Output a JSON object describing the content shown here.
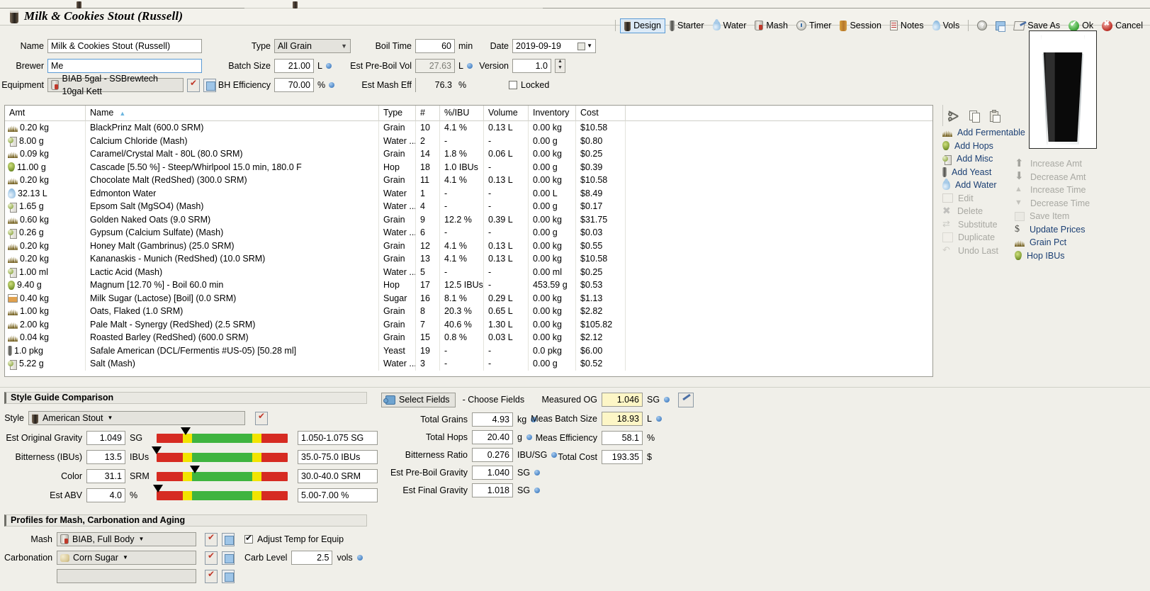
{
  "window": {
    "title": "Milk & Cookies Stout (Russell)",
    "title_icon": "beer-glass-icon"
  },
  "toolbar": {
    "items": [
      {
        "label": "Design",
        "icon": "beer-glass-icon",
        "active": true
      },
      {
        "label": "Starter",
        "icon": "test-tube-icon",
        "active": false
      },
      {
        "label": "Water",
        "icon": "water-drop-icon",
        "active": false
      },
      {
        "label": "Mash",
        "icon": "mash-tun-icon",
        "active": false
      },
      {
        "label": "Timer",
        "icon": "timer-icon",
        "active": false
      },
      {
        "label": "Session",
        "icon": "fermenter-icon",
        "active": false
      },
      {
        "label": "Notes",
        "icon": "notes-icon",
        "active": false
      },
      {
        "label": "Vols",
        "icon": "water-drop-icon",
        "active": false
      }
    ],
    "help_label": "?",
    "save_icon_label": "",
    "save_as_label": "Save As",
    "ok_label": "Ok",
    "cancel_label": "Cancel"
  },
  "form": {
    "name_label": "Name",
    "name_value": "Milk & Cookies Stout (Russell)",
    "brewer_label": "Brewer",
    "brewer_value": "Me",
    "equipment_label": "Equipment",
    "equipment_value": "BIAB 5gal - SSBrewtech 10gal Kett",
    "type_label": "Type",
    "type_value": "All Grain",
    "batch_size_label": "Batch Size",
    "batch_size_value": "21.00",
    "batch_size_unit": "L",
    "bh_efficiency_label": "BH Efficiency",
    "bh_efficiency_value": "70.00",
    "bh_efficiency_unit": "%",
    "boil_time_label": "Boil Time",
    "boil_time_value": "60",
    "boil_time_unit": "min",
    "est_pre_boil_vol_label": "Est Pre-Boil Vol",
    "est_pre_boil_vol_value": "27.63",
    "est_pre_boil_vol_unit": "L",
    "est_mash_eff_label": "Est Mash Eff",
    "est_mash_eff_value": "76.3",
    "est_mash_eff_unit": "%",
    "date_label": "Date",
    "date_value": "2019-09-19",
    "version_label": "Version",
    "version_value": "1.0",
    "locked_label": "Locked",
    "locked_checked": false
  },
  "ingredients": {
    "columns": [
      "Amt",
      "Name",
      "Type",
      "#",
      "%/IBU",
      "Volume",
      "Inventory",
      "Cost"
    ],
    "sorted_column": "Name",
    "rows": [
      {
        "icon": "grain-icon",
        "amt": "0.20 kg",
        "name": "BlackPrinz Malt (600.0 SRM)",
        "type": "Grain",
        "num": "10",
        "pct": "4.1 %",
        "volume": "0.13 L",
        "inventory": "0.00 kg",
        "cost": "$10.58"
      },
      {
        "icon": "misc-icon",
        "amt": "8.00 g",
        "name": "Calcium Chloride (Mash)",
        "type": "Water ...",
        "num": "2",
        "pct": "-",
        "volume": "-",
        "inventory": "0.00 g",
        "cost": "$0.80"
      },
      {
        "icon": "grain-icon",
        "amt": "0.09 kg",
        "name": "Caramel/Crystal Malt - 80L (80.0 SRM)",
        "type": "Grain",
        "num": "14",
        "pct": "1.8 %",
        "volume": "0.06 L",
        "inventory": "0.00 kg",
        "cost": "$0.25"
      },
      {
        "icon": "hop-icon",
        "amt": "11.00 g",
        "name": "Cascade [5.50 %] - Steep/Whirlpool  15.0 min, 180.0 F",
        "type": "Hop",
        "num": "18",
        "pct": "1.0 IBUs",
        "volume": "-",
        "inventory": "0.00 g",
        "cost": "$0.39"
      },
      {
        "icon": "grain-icon",
        "amt": "0.20 kg",
        "name": "Chocolate Malt (RedShed) (300.0 SRM)",
        "type": "Grain",
        "num": "11",
        "pct": "4.1 %",
        "volume": "0.13 L",
        "inventory": "0.00 kg",
        "cost": "$10.58"
      },
      {
        "icon": "water-icon",
        "amt": "32.13 L",
        "name": "Edmonton Water",
        "type": "Water",
        "num": "1",
        "pct": "-",
        "volume": "-",
        "inventory": "0.00 L",
        "cost": "$8.49"
      },
      {
        "icon": "misc-icon",
        "amt": "1.65 g",
        "name": "Epsom Salt (MgSO4) (Mash)",
        "type": "Water ...",
        "num": "4",
        "pct": "-",
        "volume": "-",
        "inventory": "0.00 g",
        "cost": "$0.17"
      },
      {
        "icon": "grain-icon",
        "amt": "0.60 kg",
        "name": "Golden Naked Oats (9.0 SRM)",
        "type": "Grain",
        "num": "9",
        "pct": "12.2 %",
        "volume": "0.39 L",
        "inventory": "0.00 kg",
        "cost": "$31.75"
      },
      {
        "icon": "misc-icon",
        "amt": "0.26 g",
        "name": "Gypsum (Calcium Sulfate) (Mash)",
        "type": "Water ...",
        "num": "6",
        "pct": "-",
        "volume": "-",
        "inventory": "0.00 g",
        "cost": "$0.03"
      },
      {
        "icon": "grain-icon",
        "amt": "0.20 kg",
        "name": "Honey Malt (Gambrinus) (25.0 SRM)",
        "type": "Grain",
        "num": "12",
        "pct": "4.1 %",
        "volume": "0.13 L",
        "inventory": "0.00 kg",
        "cost": "$0.55"
      },
      {
        "icon": "grain-icon",
        "amt": "0.20 kg",
        "name": "Kananaskis - Munich (RedShed) (10.0 SRM)",
        "type": "Grain",
        "num": "13",
        "pct": "4.1 %",
        "volume": "0.13 L",
        "inventory": "0.00 kg",
        "cost": "$10.58"
      },
      {
        "icon": "misc-icon",
        "amt": "1.00 ml",
        "name": "Lactic Acid (Mash)",
        "type": "Water ...",
        "num": "5",
        "pct": "-",
        "volume": "-",
        "inventory": "0.00 ml",
        "cost": "$0.25"
      },
      {
        "icon": "hop-icon",
        "amt": "9.40 g",
        "name": "Magnum [12.70 %] - Boil 60.0 min",
        "type": "Hop",
        "num": "17",
        "pct": "12.5 IBUs",
        "volume": "-",
        "inventory": "453.59 g",
        "cost": "$0.53"
      },
      {
        "icon": "sugar-icon",
        "amt": "0.40 kg",
        "name": "Milk Sugar (Lactose) [Boil] (0.0 SRM)",
        "type": "Sugar",
        "num": "16",
        "pct": "8.1 %",
        "volume": "0.29 L",
        "inventory": "0.00 kg",
        "cost": "$1.13"
      },
      {
        "icon": "grain-icon",
        "amt": "1.00 kg",
        "name": "Oats, Flaked (1.0 SRM)",
        "type": "Grain",
        "num": "8",
        "pct": "20.3 %",
        "volume": "0.65 L",
        "inventory": "0.00 kg",
        "cost": "$2.82"
      },
      {
        "icon": "grain-icon",
        "amt": "2.00 kg",
        "name": "Pale Malt - Synergy (RedShed) (2.5 SRM)",
        "type": "Grain",
        "num": "7",
        "pct": "40.6 %",
        "volume": "1.30 L",
        "inventory": "0.00 kg",
        "cost": "$105.82"
      },
      {
        "icon": "grain-icon",
        "amt": "0.04 kg",
        "name": "Roasted Barley (RedShed) (600.0 SRM)",
        "type": "Grain",
        "num": "15",
        "pct": "0.8 %",
        "volume": "0.03 L",
        "inventory": "0.00 kg",
        "cost": "$2.12"
      },
      {
        "icon": "yeast-icon",
        "amt": "1.0 pkg",
        "name": "Safale American  (DCL/Fermentis #US-05) [50.28 ml]",
        "type": "Yeast",
        "num": "19",
        "pct": "-",
        "volume": "-",
        "inventory": "0.0 pkg",
        "cost": "$6.00"
      },
      {
        "icon": "misc-icon",
        "amt": "5.22 g",
        "name": "Salt (Mash)",
        "type": "Water ...",
        "num": "3",
        "pct": "-",
        "volume": "-",
        "inventory": "0.00 g",
        "cost": "$0.52"
      }
    ]
  },
  "actions": {
    "clipboard": [
      {
        "label": "cut",
        "icon": "scissors-icon"
      },
      {
        "label": "copy",
        "icon": "copy-icon"
      },
      {
        "label": "paste",
        "icon": "paste-icon"
      }
    ],
    "primary": [
      {
        "label": "Add Fermentable",
        "icon": "grain-icon",
        "enabled": true
      },
      {
        "label": "Add Hops",
        "icon": "hop-icon",
        "enabled": true
      },
      {
        "label": "Add Misc",
        "icon": "misc-icon",
        "enabled": true
      },
      {
        "label": "Add Yeast",
        "icon": "yeast-icon",
        "enabled": true
      },
      {
        "label": "Add Water",
        "icon": "water-drop-icon",
        "enabled": true
      },
      {
        "label": "Edit",
        "icon": "edit-icon",
        "enabled": false
      },
      {
        "label": "Delete",
        "icon": "x-icon",
        "enabled": false
      },
      {
        "label": "Substitute",
        "icon": "swap-icon",
        "enabled": false
      },
      {
        "label": "Duplicate",
        "icon": "duplicate-icon",
        "enabled": false
      },
      {
        "label": "Undo Last",
        "icon": "undo-icon",
        "enabled": false
      }
    ],
    "secondary": [
      {
        "label": "Increase Amt",
        "icon": "arrow-up-icon",
        "enabled": false
      },
      {
        "label": "Decrease Amt",
        "icon": "arrow-down-icon",
        "enabled": false
      },
      {
        "label": "Increase Time",
        "icon": "triangle-up-icon",
        "enabled": false
      },
      {
        "label": "Decrease Time",
        "icon": "triangle-down-icon",
        "enabled": false
      },
      {
        "label": "Save Item",
        "icon": "disk-icon",
        "enabled": false
      },
      {
        "label": "Update Prices",
        "icon": "dollar-icon",
        "enabled": true
      },
      {
        "label": "Grain Pct",
        "icon": "grain-icon",
        "enabled": true
      },
      {
        "label": "Hop IBUs",
        "icon": "hop-icon",
        "enabled": true
      }
    ]
  },
  "style_section": {
    "header": "Style Guide Comparison",
    "style_label": "Style",
    "style_value": "American Stout",
    "rows": [
      {
        "label": "Est Original Gravity",
        "value": "1.049",
        "unit": "SG",
        "range": "1.050-1.075 SG",
        "marker_pct": 22
      },
      {
        "label": "Bitterness (IBUs)",
        "value": "13.5",
        "unit": "IBUs",
        "range": "35.0-75.0 IBUs",
        "marker_pct": 0
      },
      {
        "label": "Color",
        "value": "31.1",
        "unit": "SRM",
        "range": "30.0-40.0 SRM",
        "marker_pct": 29
      },
      {
        "label": "Est ABV",
        "value": "4.0",
        "unit": "%",
        "range": "5.00-7.00 %",
        "marker_pct": 1
      }
    ]
  },
  "stats": {
    "select_fields_label": "Select Fields",
    "choose_fields_label": "- Choose Fields",
    "left": [
      {
        "label": "Total Grains",
        "value": "4.93",
        "unit": "kg",
        "dot": true
      },
      {
        "label": "Total Hops",
        "value": "20.40",
        "unit": "g",
        "dot": true
      },
      {
        "label": "Bitterness Ratio",
        "value": "0.276",
        "unit": "IBU/SG",
        "dot": true
      },
      {
        "label": "Est Pre-Boil Gravity",
        "value": "1.040",
        "unit": "SG",
        "dot": true
      },
      {
        "label": "Est Final Gravity",
        "value": "1.018",
        "unit": "SG",
        "dot": true
      }
    ],
    "right": [
      {
        "label": "Measured OG",
        "value": "1.046",
        "unit": "SG",
        "dot": true,
        "highlight": true,
        "eyedropper": true
      },
      {
        "label": "Meas Batch Size",
        "value": "18.93",
        "unit": "L",
        "dot": true,
        "highlight": true,
        "eyedropper": false
      },
      {
        "label": "Meas Efficiency",
        "value": "58.1",
        "unit": "%",
        "dot": false,
        "highlight": false,
        "eyedropper": false
      },
      {
        "label": "Total Cost",
        "value": "193.35",
        "unit": "$",
        "dot": false,
        "highlight": false,
        "eyedropper": false
      }
    ]
  },
  "profiles": {
    "header": "Profiles for Mash, Carbonation and Aging",
    "mash_label": "Mash",
    "mash_value": "BIAB, Full Body",
    "adjust_temp_label": "Adjust Temp for Equip",
    "adjust_temp_checked": true,
    "carbonation_label": "Carbonation",
    "carbonation_value": "Corn Sugar",
    "carb_level_label": "Carb Level",
    "carb_level_value": "2.5",
    "carb_level_unit": "vols"
  },
  "colors": {
    "accent": "#5b9bd5",
    "link": "#1b3f73",
    "highlight": "#fdf6c6",
    "meter_red": "#d62b22",
    "meter_yellow": "#f2e400",
    "meter_green": "#3fb43f"
  }
}
